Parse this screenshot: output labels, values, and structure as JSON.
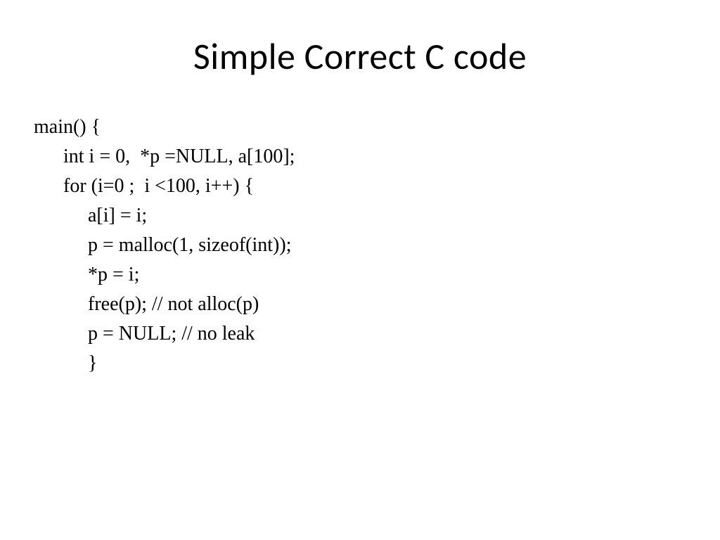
{
  "slide": {
    "title": "Simple Correct C code",
    "code": "main() {\n      int i = 0,  *p =NULL, a[100];\n      for (i=0 ;  i <100, i++) {\n           a[i] = i;\n           p = malloc(1, sizeof(int));\n           *p = i;\n           free(p); // not alloc(p)\n           p = NULL; // no leak\n           }"
  }
}
